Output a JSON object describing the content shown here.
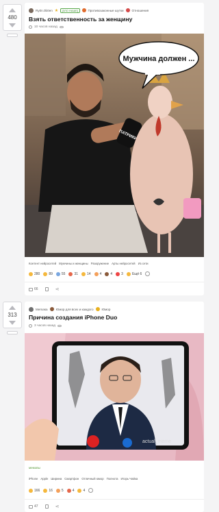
{
  "post1": {
    "score": "480",
    "author": "Ry0n.0b0en",
    "author_badge": "[ЗЛО НАШЕ]",
    "community": "Противозаконные шутки",
    "community_2": "Отношения",
    "title": "Взять ответственность за женщину",
    "time": "10 часов назад",
    "image_caption": "Мужчина должен ...",
    "mic_label": "ПАТРИКИ ТВ",
    "tags": [
      "Контент нейросетей",
      "Мужчины и женщины",
      "Разоружение",
      "Арты нейросетей",
      "Из сети"
    ],
    "reactions": [
      "280",
      "89",
      "55",
      "31",
      "14",
      "4",
      "4",
      "3",
      "Ещё 6"
    ],
    "comments": "66"
  },
  "post2": {
    "score": "313",
    "author": "Memasa",
    "community": "Юмор для всех и каждого",
    "community_2": "Юмор",
    "title": "Причина создания iPhone Duo",
    "time": "3 часов назад",
    "watermark": "actual_meme",
    "community_label": "мемовы",
    "tags": [
      "iPhone",
      "Apple",
      "Ширина",
      "Смартфон",
      "Отличный юмор",
      "Полнота",
      "Игорь Чайка"
    ],
    "reactions": [
      "166",
      "16",
      "5",
      "4",
      "4"
    ],
    "comments": "47"
  },
  "colors": {
    "accent": "#3d8f31",
    "reaction": "#f5b83d"
  }
}
